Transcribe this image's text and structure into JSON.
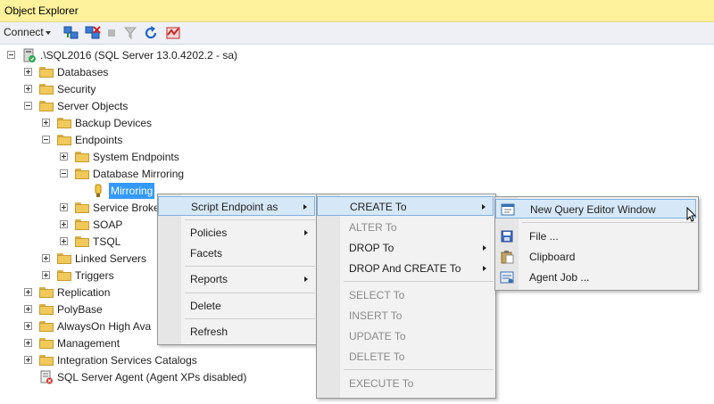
{
  "window": {
    "title": "Object Explorer"
  },
  "toolbar": {
    "connect_label": "Connect",
    "icons": [
      "connect-object-explorer-icon",
      "disconnect-icon",
      "stop-icon",
      "filter-icon",
      "refresh-icon",
      "activity-monitor-icon"
    ]
  },
  "tree": {
    "server": ".\\SQL2016 (SQL Server 13.0.4202.2 - sa)",
    "databases": "Databases",
    "security": "Security",
    "server_objects": "Server Objects",
    "backup_devices": "Backup Devices",
    "endpoints": "Endpoints",
    "system_endpoints": "System Endpoints",
    "database_mirroring": "Database Mirroring",
    "mirroring": "Mirroring",
    "service_broker": "Service Broke",
    "soap": "SOAP",
    "tsql": "TSQL",
    "linked_servers": "Linked Servers",
    "triggers": "Triggers",
    "replication": "Replication",
    "polybase": "PolyBase",
    "alwayson": "AlwaysOn High Ava",
    "management": "Management",
    "isc": "Integration Services Catalogs",
    "agent": "SQL Server Agent (Agent XPs disabled)"
  },
  "context_menu": {
    "script_endpoint_as": "Script Endpoint as",
    "policies": "Policies",
    "facets": "Facets",
    "reports": "Reports",
    "delete": "Delete",
    "refresh": "Refresh"
  },
  "script_menu": {
    "create_to": "CREATE To",
    "alter_to": "ALTER To",
    "drop_to": "DROP To",
    "drop_and_create_to": "DROP And CREATE To",
    "select_to": "SELECT To",
    "insert_to": "INSERT To",
    "update_to": "UPDATE To",
    "delete_to": "DELETE To",
    "execute_to": "EXECUTE To"
  },
  "create_menu": {
    "new_query_editor_window": "New Query Editor Window",
    "file": "File ...",
    "clipboard": "Clipboard",
    "agent_job": "Agent Job ..."
  }
}
